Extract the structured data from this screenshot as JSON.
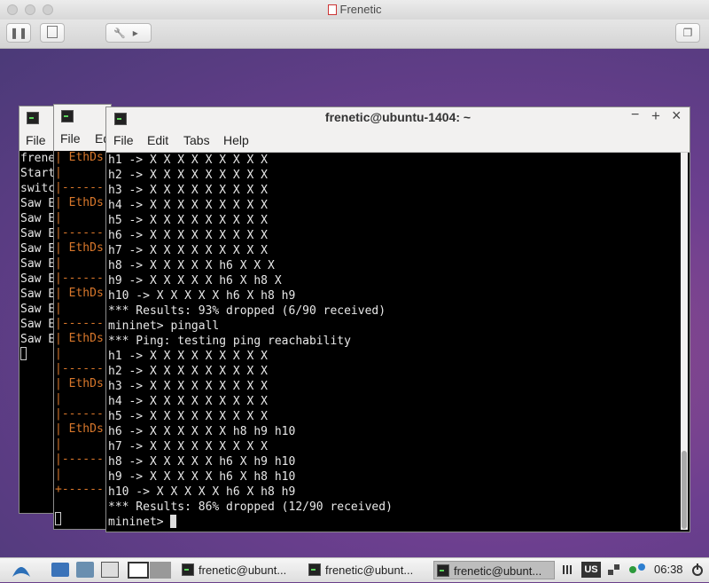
{
  "host": {
    "title": "Frenetic",
    "pause_glyph": "❚❚",
    "wrench_glyph": "🔧",
    "play_glyph": "▸",
    "restore_glyph": "❐"
  },
  "back_term": {
    "menu_file": "File",
    "lines": [
      "frene",
      "Start",
      "switc",
      "Saw E",
      "Saw E",
      "Saw E",
      "Saw E",
      "Saw E",
      "Saw E",
      "Saw E",
      "Saw E",
      "Saw E",
      "Saw E"
    ]
  },
  "mid_term": {
    "menu_file": "File",
    "menu_edit": "Ed",
    "label": "EthDs",
    "pipe": "|",
    "dash": "|------",
    "corner": "+------"
  },
  "front_term": {
    "title": "frenetic@ubuntu-1404: ~",
    "minimize_glyph": "−",
    "maximize_glyph": "+",
    "close_glyph": "×",
    "menu": [
      "File",
      "Edit",
      "Tabs",
      "Help"
    ],
    "lines": [
      "h1 -> X X X X X X X X X",
      "h2 -> X X X X X X X X X",
      "h3 -> X X X X X X X X X",
      "h4 -> X X X X X X X X X",
      "h5 -> X X X X X X X X X",
      "h6 -> X X X X X X X X X",
      "h7 -> X X X X X X X X X",
      "h8 -> X X X X X h6 X X X",
      "h9 -> X X X X X h6 X h8 X",
      "h10 -> X X X X X h6 X h8 h9",
      "*** Results: 93% dropped (6/90 received)",
      "mininet> pingall",
      "*** Ping: testing ping reachability",
      "h1 -> X X X X X X X X X",
      "h2 -> X X X X X X X X X",
      "h3 -> X X X X X X X X X",
      "h4 -> X X X X X X X X X",
      "h5 -> X X X X X X X X X",
      "h6 -> X X X X X X h8 h9 h10",
      "h7 -> X X X X X X X X X",
      "h8 -> X X X X X h6 X h9 h10",
      "h9 -> X X X X X h6 X h8 h10",
      "h10 -> X X X X X h6 X h8 h9",
      "*** Results: 86% dropped (12/90 received)"
    ],
    "prompt": "mininet> "
  },
  "taskbar": {
    "tasks": [
      "frenetic@ubunt...",
      "frenetic@ubunt...",
      "frenetic@ubunt..."
    ],
    "keyboard_layout": "US",
    "clock": "06:38"
  }
}
